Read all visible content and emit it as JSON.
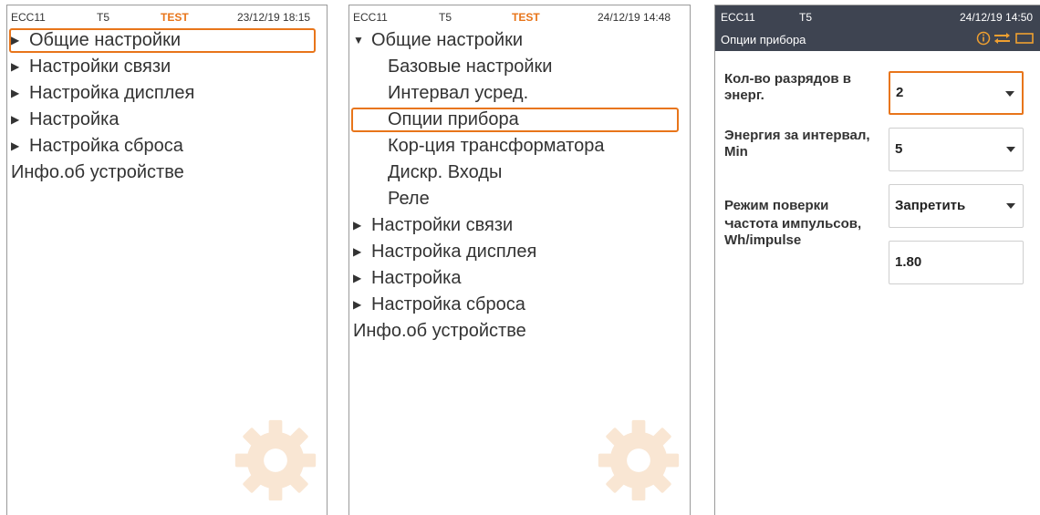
{
  "screen1": {
    "status": {
      "device": "ECC11",
      "tariff": "T5",
      "mode": "TEST",
      "datetime": "23/12/19 18:15"
    },
    "menu": [
      {
        "label": "Общие настройки",
        "arrow": "▶"
      },
      {
        "label": "Настройки связи",
        "arrow": "▶"
      },
      {
        "label": "Настройка дисплея",
        "arrow": "▶"
      },
      {
        "label": "Настройка",
        "arrow": "▶"
      },
      {
        "label": "Настройка сброса",
        "arrow": "▶"
      },
      {
        "label": "Инфо.об устройстве",
        "arrow": ""
      }
    ],
    "selected": "Общие настройки"
  },
  "screen2": {
    "status": {
      "device": "ECC11",
      "tariff": "T5",
      "mode": "TEST",
      "datetime": "24/12/19 14:48"
    },
    "menu": [
      {
        "label": "Общие настройки",
        "arrow": "▼"
      },
      {
        "label": "Базовые настройки"
      },
      {
        "label": "Интервал усред."
      },
      {
        "label": "Опции прибора"
      },
      {
        "label": "Кор-ция трансформатора"
      },
      {
        "label": "Дискр. Входы"
      },
      {
        "label": "Реле"
      },
      {
        "label": "Настройки связи",
        "arrow": "▶"
      },
      {
        "label": "Настройка дисплея",
        "arrow": "▶"
      },
      {
        "label": "Настройка",
        "arrow": "▶"
      },
      {
        "label": "Настройка сброса",
        "arrow": "▶"
      },
      {
        "label": "Инфо.об устройстве"
      }
    ],
    "selected": "Опции прибора"
  },
  "screen3": {
    "status": {
      "device": "ECC11",
      "tariff": "T5",
      "datetime": "24/12/19 14:50"
    },
    "title": "Опции прибора",
    "header_icons": [
      "info-icon",
      "transfer-icon",
      "battery-icon"
    ],
    "fields": [
      {
        "label": "Кол-во разрядов в энерг.",
        "value": "2",
        "type": "select",
        "focused": true
      },
      {
        "label": "Энергия за интервал, Min",
        "value": "5",
        "type": "select"
      },
      {
        "label": "Режим поверки",
        "value": "Запретить",
        "type": "select"
      },
      {
        "label": "Частота импульсов, Wh/impulse",
        "value": "1.80",
        "type": "input"
      }
    ]
  },
  "colors": {
    "accent": "#e8751a",
    "header_bg": "#3e4451",
    "border": "#9a9a9a",
    "gear": "#f9e6d3"
  }
}
